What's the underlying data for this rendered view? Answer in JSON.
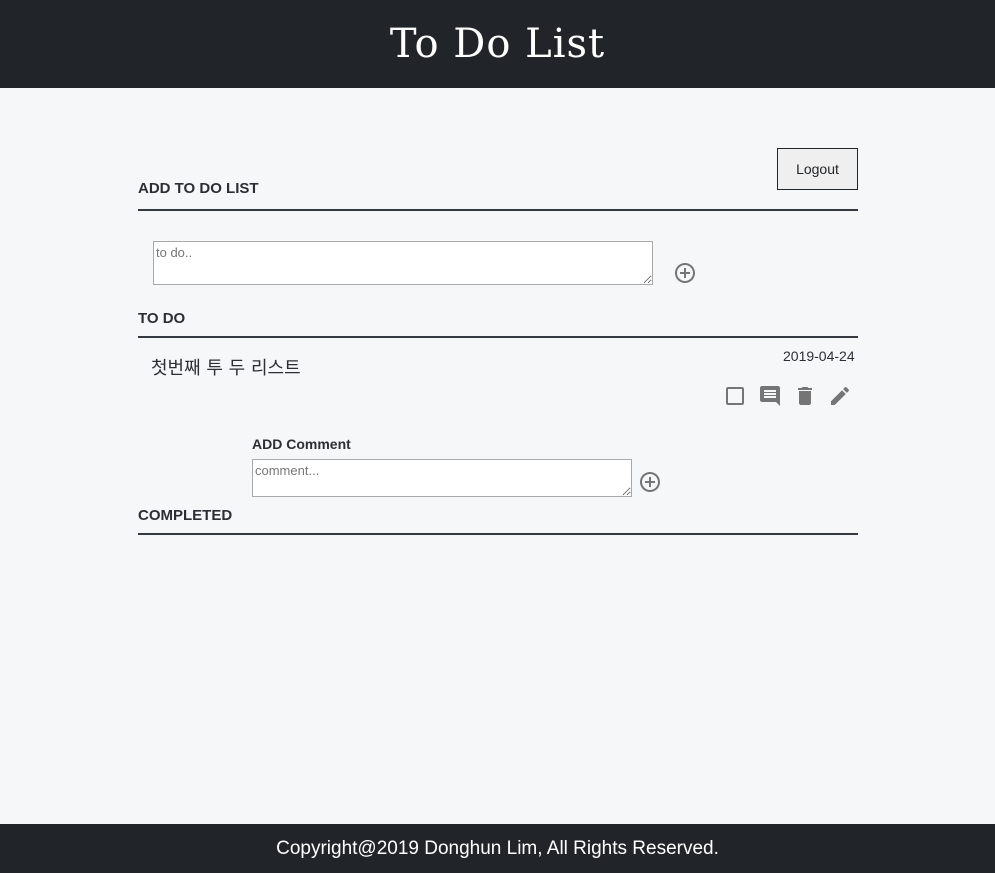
{
  "header": {
    "title": "To Do List"
  },
  "auth": {
    "logout_label": "Logout"
  },
  "add_section": {
    "title": "ADD TO DO LIST",
    "input_placeholder": "to do..",
    "input_value": "",
    "add_icon": "add-circle-icon"
  },
  "todo_section": {
    "title": "TO DO",
    "items": [
      {
        "text": "첫번째 투 두 리스트",
        "date": "2019-04-24",
        "actions": [
          "checkbox-icon",
          "comment-icon",
          "delete-icon",
          "edit-icon"
        ],
        "comment": {
          "label": "ADD Comment",
          "placeholder": "comment...",
          "value": ""
        }
      }
    ]
  },
  "completed_section": {
    "title": "COMPLETED",
    "items": []
  },
  "footer": {
    "copyright": "Copyright@2019 Donghun Lim, All Rights Reserved."
  },
  "colors": {
    "header_bg": "#212529",
    "page_bg": "#f6f7f9",
    "icon_gray": "#757575",
    "divider": "#343a40"
  }
}
